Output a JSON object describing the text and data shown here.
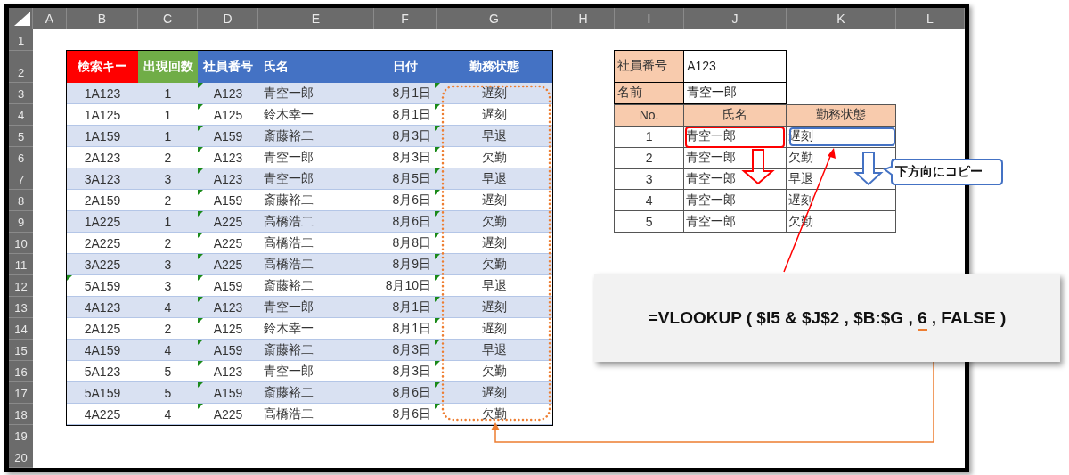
{
  "sheet": {
    "columns": [
      "A",
      "B",
      "C",
      "D",
      "E",
      "F",
      "G",
      "H",
      "I",
      "J",
      "K",
      "L"
    ],
    "rows": [
      "1",
      "2",
      "3",
      "4",
      "5",
      "6",
      "7",
      "8",
      "9",
      "10",
      "11",
      "12",
      "13",
      "14",
      "15",
      "16",
      "17",
      "18",
      "19",
      "20"
    ]
  },
  "main_table": {
    "headers": [
      {
        "label": "検索キー",
        "color": "#ff0000"
      },
      {
        "label": "出現回数",
        "color": "#70ad47"
      },
      {
        "label": "社員番号",
        "color": "#4472c4"
      },
      {
        "label": "氏名",
        "color": "#4472c4"
      },
      {
        "label": "日付",
        "color": "#4472c4"
      },
      {
        "label": "勤務状態",
        "color": "#4472c4"
      }
    ],
    "rows": [
      {
        "key": "1A123",
        "count": "1",
        "id": "A123",
        "name": "青空一郎",
        "date": "8月1日",
        "status": "遅刻",
        "flag_key": false,
        "flag_id": true,
        "flag_date": true
      },
      {
        "key": "1A125",
        "count": "1",
        "id": "A125",
        "name": "鈴木幸一",
        "date": "8月1日",
        "status": "遅刻",
        "flag_key": false,
        "flag_id": true,
        "flag_date": true
      },
      {
        "key": "1A159",
        "count": "1",
        "id": "A159",
        "name": "斎藤裕二",
        "date": "8月3日",
        "status": "早退",
        "flag_key": false,
        "flag_id": true,
        "flag_date": true
      },
      {
        "key": "2A123",
        "count": "2",
        "id": "A123",
        "name": "青空一郎",
        "date": "8月3日",
        "status": "欠勤",
        "flag_key": false,
        "flag_id": true,
        "flag_date": true
      },
      {
        "key": "3A123",
        "count": "3",
        "id": "A123",
        "name": "青空一郎",
        "date": "8月5日",
        "status": "早退",
        "flag_key": false,
        "flag_id": true,
        "flag_date": true
      },
      {
        "key": "2A159",
        "count": "2",
        "id": "A159",
        "name": "斎藤裕二",
        "date": "8月6日",
        "status": "遅刻",
        "flag_key": false,
        "flag_id": true,
        "flag_date": true
      },
      {
        "key": "1A225",
        "count": "1",
        "id": "A225",
        "name": "高橋浩二",
        "date": "8月6日",
        "status": "欠勤",
        "flag_key": false,
        "flag_id": true,
        "flag_date": true
      },
      {
        "key": "2A225",
        "count": "2",
        "id": "A225",
        "name": "高橋浩二",
        "date": "8月8日",
        "status": "遅刻",
        "flag_key": false,
        "flag_id": true,
        "flag_date": true
      },
      {
        "key": "3A225",
        "count": "3",
        "id": "A225",
        "name": "高橋浩二",
        "date": "8月9日",
        "status": "欠勤",
        "flag_key": false,
        "flag_id": true,
        "flag_date": true
      },
      {
        "key": "5A159",
        "count": "3",
        "id": "A159",
        "name": "斎藤裕二",
        "date": "8月10日",
        "status": "早退",
        "flag_key": true,
        "flag_id": true,
        "flag_date": true
      },
      {
        "key": "4A123",
        "count": "4",
        "id": "A123",
        "name": "青空一郎",
        "date": "8月1日",
        "status": "遅刻",
        "flag_key": false,
        "flag_id": true,
        "flag_date": true
      },
      {
        "key": "2A125",
        "count": "2",
        "id": "A125",
        "name": "鈴木幸一",
        "date": "8月1日",
        "status": "遅刻",
        "flag_key": false,
        "flag_id": true,
        "flag_date": true
      },
      {
        "key": "4A159",
        "count": "4",
        "id": "A159",
        "name": "斎藤裕二",
        "date": "8月3日",
        "status": "早退",
        "flag_key": false,
        "flag_id": true,
        "flag_date": true
      },
      {
        "key": "5A123",
        "count": "5",
        "id": "A123",
        "name": "青空一郎",
        "date": "8月3日",
        "status": "欠勤",
        "flag_key": false,
        "flag_id": true,
        "flag_date": true
      },
      {
        "key": "5A159",
        "count": "5",
        "id": "A159",
        "name": "斎藤裕二",
        "date": "8月6日",
        "status": "遅刻",
        "flag_key": false,
        "flag_id": true,
        "flag_date": true
      },
      {
        "key": "4A225",
        "count": "4",
        "id": "A225",
        "name": "高橋浩二",
        "date": "8月6日",
        "status": "欠勤",
        "flag_key": false,
        "flag_id": true,
        "flag_date": true
      }
    ]
  },
  "search_fields": [
    {
      "label": "社員番号",
      "value": "A123"
    },
    {
      "label": "名前",
      "value": "青空一郎"
    }
  ],
  "result_table": {
    "headers": [
      "No.",
      "氏名",
      "勤務状態"
    ],
    "rows": [
      {
        "no": "1",
        "name": "青空一郎",
        "status": "遅刻"
      },
      {
        "no": "2",
        "name": "青空一郎",
        "status": "欠勤"
      },
      {
        "no": "3",
        "name": "青空一郎",
        "status": "早退"
      },
      {
        "no": "4",
        "name": "青空一郎",
        "status": "遅刻"
      },
      {
        "no": "5",
        "name": "青空一郎",
        "status": "欠勤"
      }
    ]
  },
  "callout": "下方向にコピー",
  "formula": {
    "before": "=VLOOKUP ( $I5 & $J$2 , $B:$G , ",
    "highlight": "6",
    "after": " , FALSE )"
  }
}
